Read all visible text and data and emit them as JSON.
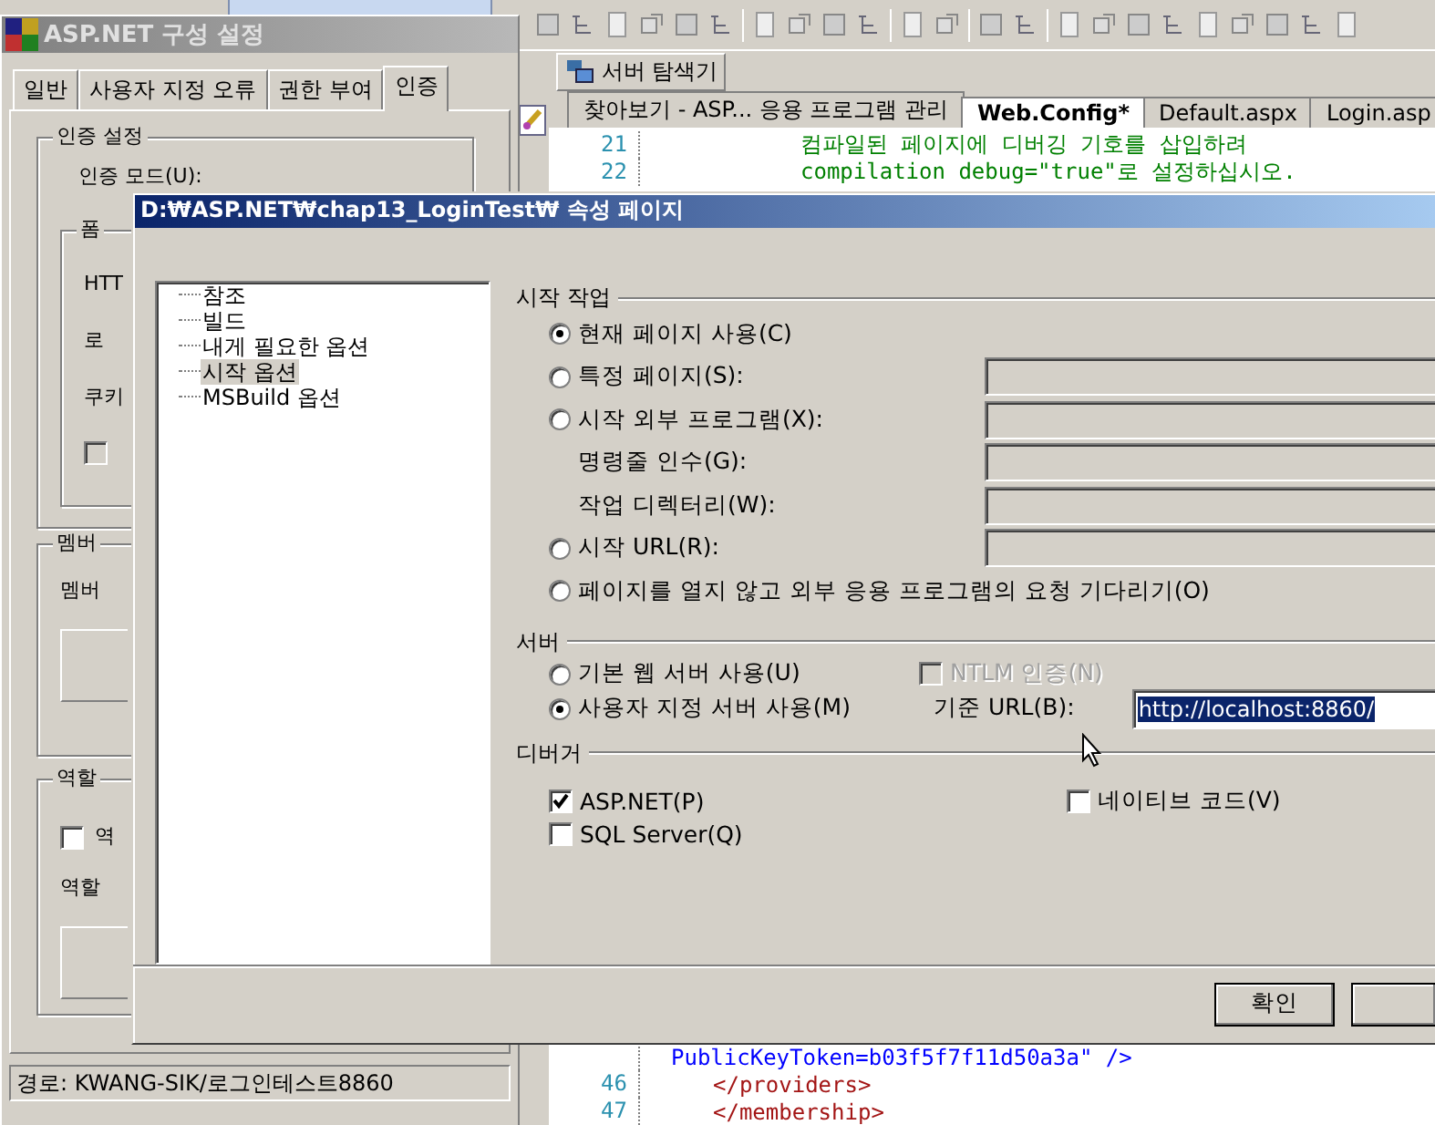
{
  "editor": {
    "explorer_button": "서버 탐색기",
    "tabs": [
      {
        "label": "찾아보기 - ASP... 응용 프로그램 관리",
        "selected": false
      },
      {
        "label": "Web.Config*",
        "selected": true
      },
      {
        "label": "Default.aspx",
        "selected": false
      },
      {
        "label": "Login.asp",
        "selected": false
      }
    ],
    "code_top": [
      {
        "line": "21",
        "kind": "comment",
        "text": "컴파일된 페이지에 디버깅 기호를 삽입하려"
      },
      {
        "line": "22",
        "kind": "comment",
        "text": "compilation debug=\"true\"로 설정하십시오."
      }
    ],
    "code_bottom": [
      {
        "kind": "attribute",
        "text": "PublicKeyToken=b03f5f7f11d50a3a\" />"
      },
      {
        "line": "46",
        "kind": "tag",
        "text": "</providers>"
      },
      {
        "line": "47",
        "kind": "tag",
        "text": "</membership>"
      }
    ]
  },
  "config_window": {
    "title": "ASP.NET 구성 설정",
    "tabs": [
      {
        "label": "일반",
        "selected": false
      },
      {
        "label": "사용자 지정 오류",
        "selected": false
      },
      {
        "label": "권한 부여",
        "selected": false
      },
      {
        "label": "인증",
        "selected": true
      }
    ],
    "auth_group": "인증 설정",
    "auth_mode_label": "인증 모드(U):",
    "forms_group": "폼",
    "forms_labels": [
      "HTT",
      "로",
      "쿠키"
    ],
    "forms_checkbox": {
      "checked": false,
      "disabled": true
    },
    "membership_group": "멤버",
    "membership_label": "멤버",
    "roles_group": "역할",
    "roles_checkbox": {
      "label": "역",
      "checked": false
    },
    "roles_label": "역할",
    "status": "경로: KWANG-SIK/로그인테스트8860"
  },
  "dialog": {
    "title": "D:₩ASP.NET₩chap13_LoginTest₩ 속성 페이지",
    "tree": [
      {
        "label": "참조",
        "selected": false
      },
      {
        "label": "빌드",
        "selected": false
      },
      {
        "label": "내게 필요한 옵션",
        "selected": false
      },
      {
        "label": "시작 옵션",
        "selected": true
      },
      {
        "label": "MSBuild 옵션",
        "selected": false
      }
    ],
    "start_action": {
      "title": "시작 작업",
      "rows": [
        {
          "kind": "radio",
          "label": "현재 페이지 사용(C)",
          "selected": true
        },
        {
          "kind": "radio-field",
          "label": "특정 페이지(S):",
          "selected": false
        },
        {
          "kind": "radio-field",
          "label": "시작 외부 프로그램(X):",
          "selected": false
        },
        {
          "kind": "label-field",
          "label": "명령줄 인수(G):"
        },
        {
          "kind": "label-field",
          "label": "작업 디렉터리(W):"
        },
        {
          "kind": "radio-field",
          "label": "시작 URL(R):",
          "selected": false
        },
        {
          "kind": "radio",
          "label": "페이지를 열지 않고 외부 응용 프로그램의 요청 기다리기(O)",
          "selected": false
        }
      ]
    },
    "server": {
      "title": "서버",
      "options": [
        {
          "label": "기본 웹 서버 사용(U)",
          "selected": false
        },
        {
          "label": "사용자 지정 서버 사용(M)",
          "selected": true
        }
      ],
      "ntlm": {
        "label": "NTLM 인증(N)",
        "checked": false,
        "disabled": true
      },
      "base_url": {
        "label": "기준 URL(B):",
        "value": "http://localhost:8860/"
      }
    },
    "debuggers": {
      "title": "디버거",
      "items": [
        {
          "label": "ASP.NET(P)",
          "checked": true
        },
        {
          "label": "SQL Server(Q)",
          "checked": false
        },
        {
          "label": "네이티브 코드(V)",
          "checked": false
        }
      ]
    },
    "buttons": [
      "확인"
    ]
  }
}
